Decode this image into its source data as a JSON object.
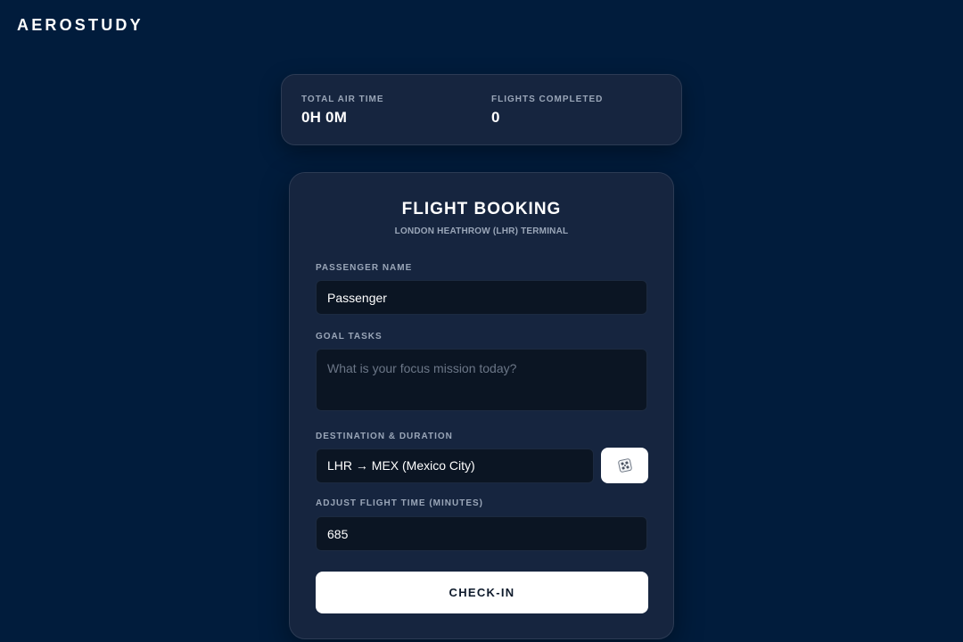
{
  "brand": "AEROSTUDY",
  "stats": {
    "total_air_time_label": "TOTAL AIR TIME",
    "total_air_time_value": "0H 0M",
    "flights_completed_label": "FLIGHTS COMPLETED",
    "flights_completed_value": "0"
  },
  "booking": {
    "title": "FLIGHT BOOKING",
    "subtitle": "LONDON HEATHROW (LHR) TERMINAL",
    "passenger_label": "PASSENGER NAME",
    "passenger_value": "Passenger",
    "goal_label": "GOAL TASKS",
    "goal_placeholder": "What is your focus mission today?",
    "destination_label": "DESTINATION & DURATION",
    "destination_value": "LHR → MEX (Mexico City)",
    "dice_icon": "dice-icon",
    "flight_time_label": "ADJUST FLIGHT TIME (MINUTES)",
    "flight_time_value": "685",
    "checkin_label": "CHECK-IN"
  },
  "colors": {
    "background": "#011c3c",
    "card": "#16253f",
    "input": "#0b1523",
    "muted_text": "#9aa6b8",
    "button": "#ffffff"
  }
}
